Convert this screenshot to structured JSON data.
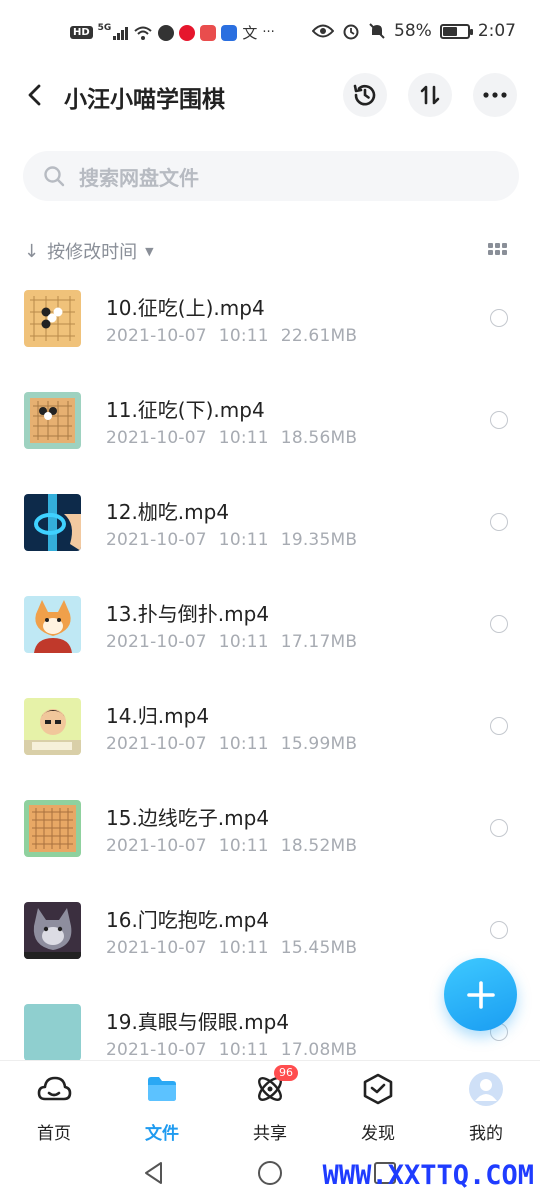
{
  "status_bar": {
    "hd": "HD",
    "network": "5G",
    "translate_glyph": "文",
    "more": "···",
    "battery_text": "58%",
    "battery_level": 0.58,
    "time": "2:07"
  },
  "header": {
    "back_icon": "chevron-left-icon",
    "title": "小汪小喵学围棋",
    "actions": [
      "history-icon",
      "sort-swap-icon",
      "more-icon"
    ]
  },
  "search": {
    "placeholder": "搜索网盘文件"
  },
  "sort": {
    "arrow": "↓",
    "label": "按修改时间",
    "caret": "▼"
  },
  "files": [
    {
      "name": "10.征吃(上).mp4",
      "date": "2021-10-07",
      "time": "10:11",
      "size": "22.61MB"
    },
    {
      "name": "11.征吃(下).mp4",
      "date": "2021-10-07",
      "time": "10:11",
      "size": "18.56MB"
    },
    {
      "name": "12.枷吃.mp4",
      "date": "2021-10-07",
      "time": "10:11",
      "size": "19.35MB"
    },
    {
      "name": "13.扑与倒扑.mp4",
      "date": "2021-10-07",
      "time": "10:11",
      "size": "17.17MB"
    },
    {
      "name": "14.归.mp4",
      "date": "2021-10-07",
      "time": "10:11",
      "size": "15.99MB"
    },
    {
      "name": "15.边线吃子.mp4",
      "date": "2021-10-07",
      "time": "10:11",
      "size": "18.52MB"
    },
    {
      "name": "16.门吃抱吃.mp4",
      "date": "2021-10-07",
      "time": "10:11",
      "size": "15.45MB"
    },
    {
      "name": "19.真眼与假眼.mp4",
      "date": "2021-10-07",
      "time": "10:11",
      "size": "17.08MB"
    }
  ],
  "fab": {
    "icon": "plus-icon"
  },
  "bottom_nav": {
    "items": [
      {
        "label": "首页",
        "icon": "cloud-home-icon"
      },
      {
        "label": "文件",
        "icon": "folder-icon",
        "active": true
      },
      {
        "label": "共享",
        "icon": "atom-share-icon",
        "badge": "96"
      },
      {
        "label": "发现",
        "icon": "cube-discover-icon"
      },
      {
        "label": "我的",
        "icon": "avatar-icon"
      }
    ]
  },
  "watermark": "WWW.XXTTQ.COM",
  "colors": {
    "accent": "#1f9bf0",
    "badge": "#ff4d4f",
    "meta_text": "#a7abb2"
  }
}
